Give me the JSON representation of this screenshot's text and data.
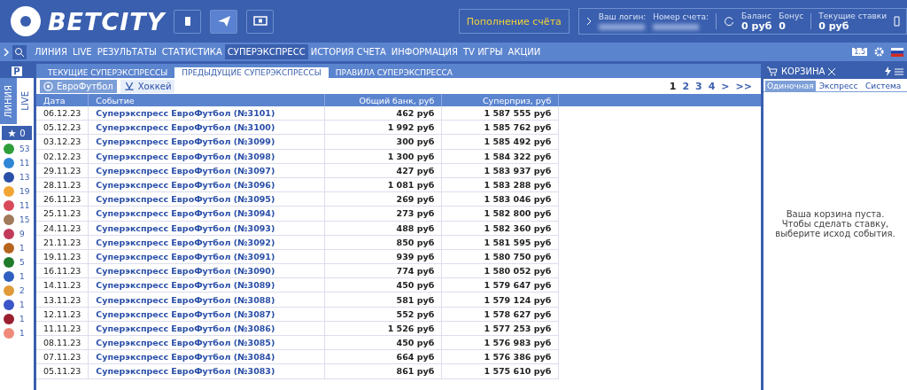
{
  "header": {
    "logo": "BETCITY",
    "deposit_button": "Пополнение счёта",
    "login_label": "Ваш логин:",
    "account_label": "Номер счета:",
    "balance_label": "Баланс",
    "balance_value": "0 руб",
    "bonus_label": "Бонус",
    "bonus_value": "0",
    "bets_label": "Текущие ставки",
    "bets_value": "0 руб"
  },
  "nav": {
    "items": [
      {
        "label": "ЛИНИЯ",
        "selected": false
      },
      {
        "label": "LIVE",
        "selected": false
      },
      {
        "label": "РЕЗУЛЬТАТЫ",
        "selected": false
      },
      {
        "label": "СТАТИСТИКА",
        "selected": false
      },
      {
        "label": "СУПЕРЭКСПРЕСС",
        "selected": true
      },
      {
        "label": "ИСТОРИЯ СЧЕТА",
        "selected": false
      },
      {
        "label": "ИНФОРМАЦИЯ",
        "selected": false
      },
      {
        "label": "TV ИГРЫ",
        "selected": false
      },
      {
        "label": "АКЦИИ",
        "selected": false
      }
    ],
    "odds_badge": "1.5"
  },
  "sidebar": {
    "top_badge": "P",
    "tabs": [
      {
        "label": "ЛИНИЯ",
        "selected": false
      },
      {
        "label": "LIVE",
        "selected": true
      }
    ],
    "favorites": "0",
    "sports": [
      {
        "count": "53",
        "color": "#2f9e3a"
      },
      {
        "count": "11",
        "color": "#2f86d6"
      },
      {
        "count": "13",
        "color": "#2a4fa8"
      },
      {
        "count": "19",
        "color": "#f0a534"
      },
      {
        "count": "11",
        "color": "#d84a5a"
      },
      {
        "count": "15",
        "color": "#a07a5a"
      },
      {
        "count": "9",
        "color": "#c23a5a"
      },
      {
        "count": "1",
        "color": "#b5651d"
      },
      {
        "count": "5",
        "color": "#1f7a2a"
      },
      {
        "count": "1",
        "color": "#2f5fc0"
      },
      {
        "count": "2",
        "color": "#e09a3a"
      },
      {
        "count": "1",
        "color": "#3a56c8"
      },
      {
        "count": "1",
        "color": "#9a1f2e"
      },
      {
        "count": "1",
        "color": "#f08a7a"
      }
    ]
  },
  "tabs": [
    {
      "label": "ТЕКУЩИЕ СУПЕРЭКСПРЕССЫ",
      "selected": false
    },
    {
      "label": "ПРЕДЫДУЩИЕ СУПЕРЭКСПРЕССЫ",
      "selected": true
    },
    {
      "label": "ПРАВИЛА СУПЕРЭКСПРЕССА",
      "selected": false
    }
  ],
  "filters": [
    {
      "label": "ЕвроФутбол",
      "selected": true,
      "kind": "ball"
    },
    {
      "label": "Хоккей",
      "selected": false,
      "kind": "sticks"
    }
  ],
  "pagination": [
    {
      "label": "1",
      "selected": true
    },
    {
      "label": "2",
      "selected": false
    },
    {
      "label": "3",
      "selected": false
    },
    {
      "label": "4",
      "selected": false
    },
    {
      "label": ">",
      "selected": false
    },
    {
      "label": ">>",
      "selected": false
    }
  ],
  "table": {
    "columns": [
      "Дата",
      "Событие",
      "Общий банк, руб",
      "Суперприз, руб"
    ],
    "rows": [
      [
        "06.12.23",
        "Суперэкспресс ЕвроФутбол (№3101)",
        "462 руб",
        "1 587 555 руб"
      ],
      [
        "05.12.23",
        "Суперэкспресс ЕвроФутбол (№3100)",
        "1 992 руб",
        "1 585 762 руб"
      ],
      [
        "03.12.23",
        "Суперэкспресс ЕвроФутбол (№3099)",
        "300 руб",
        "1 585 492 руб"
      ],
      [
        "02.12.23",
        "Суперэкспресс ЕвроФутбол (№3098)",
        "1 300 руб",
        "1 584 322 руб"
      ],
      [
        "29.11.23",
        "Суперэкспресс ЕвроФутбол (№3097)",
        "427 руб",
        "1 583 937 руб"
      ],
      [
        "28.11.23",
        "Суперэкспресс ЕвроФутбол (№3096)",
        "1 081 руб",
        "1 583 288 руб"
      ],
      [
        "26.11.23",
        "Суперэкспресс ЕвроФутбол (№3095)",
        "269 руб",
        "1 583 046 руб"
      ],
      [
        "25.11.23",
        "Суперэкспресс ЕвроФутбол (№3094)",
        "273 руб",
        "1 582 800 руб"
      ],
      [
        "24.11.23",
        "Суперэкспресс ЕвроФутбол (№3093)",
        "488 руб",
        "1 582 360 руб"
      ],
      [
        "21.11.23",
        "Суперэкспресс ЕвроФутбол (№3092)",
        "850 руб",
        "1 581 595 руб"
      ],
      [
        "19.11.23",
        "Суперэкспресс ЕвроФутбол (№3091)",
        "939 руб",
        "1 580 750 руб"
      ],
      [
        "16.11.23",
        "Суперэкспресс ЕвроФутбол (№3090)",
        "774 руб",
        "1 580 052 руб"
      ],
      [
        "14.11.23",
        "Суперэкспресс ЕвроФутбол (№3089)",
        "450 руб",
        "1 579 647 руб"
      ],
      [
        "13.11.23",
        "Суперэкспресс ЕвроФутбол (№3088)",
        "581 руб",
        "1 579 124 руб"
      ],
      [
        "12.11.23",
        "Суперэкспресс ЕвроФутбол (№3087)",
        "552 руб",
        "1 578 627 руб"
      ],
      [
        "11.11.23",
        "Суперэкспресс ЕвроФутбол (№3086)",
        "1 526 руб",
        "1 577 253 руб"
      ],
      [
        "08.11.23",
        "Суперэкспресс ЕвроФутбол (№3085)",
        "450 руб",
        "1 576 983 руб"
      ],
      [
        "07.11.23",
        "Суперэкспресс ЕвроФутбол (№3084)",
        "664 руб",
        "1 576 386 руб"
      ],
      [
        "05.11.23",
        "Суперэкспресс ЕвроФутбол (№3083)",
        "861 руб",
        "1 575 610 руб"
      ]
    ]
  },
  "cart": {
    "title": "КОРЗИНА",
    "tabs": [
      {
        "label": "Одиночная",
        "selected": true
      },
      {
        "label": "Экспресс",
        "selected": false
      },
      {
        "label": "Система",
        "selected": false
      }
    ],
    "empty_message": "Ваша корзина пуста.\nЧтобы сделать ставку, выберите исход события."
  }
}
